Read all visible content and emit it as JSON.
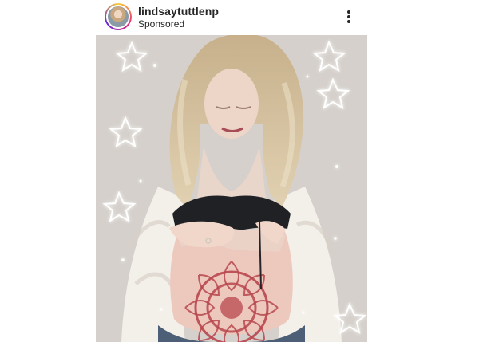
{
  "post": {
    "username": "lindsaytuttlenp",
    "label": "Sponsored"
  },
  "icons": {
    "avatar": "profile-photo",
    "more": "more-options-icon"
  },
  "colors": {
    "text": "#262626",
    "story_ring": [
      "#f9ce34",
      "#ee2a7b",
      "#6228d7"
    ],
    "henna": "#b8474f"
  }
}
